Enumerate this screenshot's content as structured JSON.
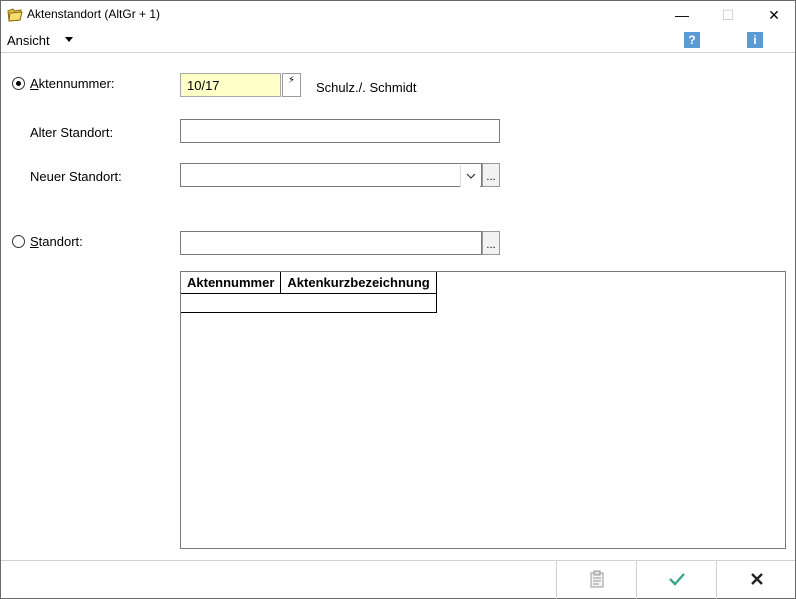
{
  "window": {
    "title": "Aktenstandort (AltGr + 1)",
    "minimize_glyph": "—",
    "maximize_glyph": "☐",
    "close_glyph": "✕"
  },
  "menu": {
    "ansicht_label": "Ansicht",
    "help_glyph": "?",
    "info_glyph": "i"
  },
  "form": {
    "aktennummer": {
      "label_access": "A",
      "label_rest": "ktennummer:",
      "value": "10/17",
      "selected": true,
      "case_name": "Schulz./. Schmidt",
      "lightning_glyph": "⚡"
    },
    "alter_standort": {
      "label": "Alter Standort:",
      "value": ""
    },
    "neuer_standort": {
      "label": "Neuer Standort:",
      "value": "",
      "browse_label": "..."
    },
    "standort": {
      "label_access": "S",
      "label_rest": "tandort:",
      "value": "",
      "selected": false,
      "browse_label": "..."
    }
  },
  "grid": {
    "columns": [
      "Aktennummer",
      "Aktenkurzbezeichnung"
    ],
    "rows": []
  },
  "colors": {
    "input_highlight": "#ffffc8",
    "ok_check": "#3aa58a",
    "icon_blue": "#5b9bd5"
  }
}
